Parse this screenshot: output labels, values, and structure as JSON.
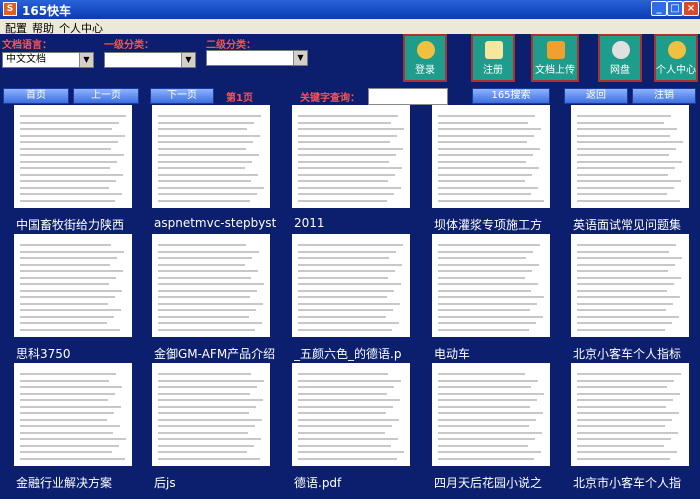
{
  "window": {
    "title": "165快车",
    "app_icon": "S",
    "controls": {
      "minimize": "_",
      "maximize": "□",
      "close": "×"
    }
  },
  "menu": [
    "配置",
    "帮助",
    "个人中心"
  ],
  "filters": {
    "language_label": "文档语言：",
    "language_value": "中文文档",
    "level1_label": "一级分类：",
    "level1_value": "",
    "level2_label": "二级分类：",
    "level2_value": ""
  },
  "big_buttons": [
    {
      "label": "登录",
      "icon": "user-icon",
      "color": "#f0c040"
    },
    {
      "label": "注册",
      "icon": "register-icon",
      "color": "#f5e6a0"
    },
    {
      "label": "文档上传",
      "icon": "upload-icon",
      "color": "#f0a030"
    },
    {
      "label": "网盘",
      "icon": "disk-icon",
      "color": "#e0e0e0"
    },
    {
      "label": "个人中心",
      "icon": "person-icon",
      "color": "#f0c040"
    }
  ],
  "nav": {
    "first": "首页",
    "prev": "上一页",
    "next": "下一页",
    "page": "第1页",
    "keyword_label": "关键字查询：",
    "keyword_value": "",
    "search": "165搜索",
    "back": "返回",
    "logout": "注销"
  },
  "documents": [
    {
      "caption": "中国畜牧街给力陕西"
    },
    {
      "caption": "aspnetmvc-stepbyst"
    },
    {
      "caption": "2011"
    },
    {
      "caption": "坝体灌浆专项施工方"
    },
    {
      "caption": "英语面试常见问题集"
    },
    {
      "caption": "思科3750"
    },
    {
      "caption": "金御GM-AFM产品介绍"
    },
    {
      "caption": "_五颜六色_的德语.p"
    },
    {
      "caption": "电动车"
    },
    {
      "caption": "北京小客车个人指标"
    },
    {
      "caption": "金融行业解决方案"
    },
    {
      "caption": "后js"
    },
    {
      "caption": "德语.pdf"
    },
    {
      "caption": "四月天后花园小说之"
    },
    {
      "caption": "北京市小客车个人指"
    }
  ]
}
